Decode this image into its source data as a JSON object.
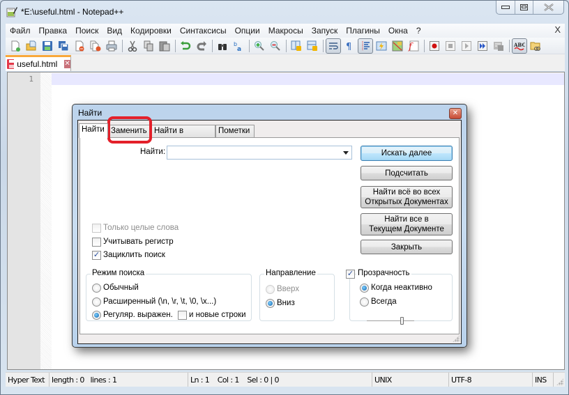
{
  "window": {
    "title": "*E:\\useful.html - Notepad++",
    "controls": [
      "minimize",
      "maximize",
      "close"
    ]
  },
  "menubar": {
    "items": [
      "Файл",
      "Правка",
      "Поиск",
      "Вид",
      "Кодировки",
      "Синтаксисы",
      "Опции",
      "Макросы",
      "Запуск",
      "Плагины",
      "Окна",
      "?"
    ],
    "close_label": "X"
  },
  "toolbar": {
    "buttons": [
      "new-file",
      "open-file",
      "save",
      "save-all",
      "close",
      "close-all",
      "print",
      "cut",
      "copy",
      "paste",
      "undo",
      "redo",
      "find",
      "replace",
      "zoom-in",
      "zoom-out",
      "sync-vertical",
      "sync-horizontal",
      "word-wrap",
      "show-all-chars",
      "indent-guide",
      "user-defined-language",
      "document-map",
      "function-list",
      "macro-record",
      "macro-stop",
      "macro-play",
      "macro-run-multiple",
      "macro-save",
      "spell-check",
      "folder-as-workspace"
    ]
  },
  "tabs": [
    {
      "label": "useful.html",
      "modified": true
    }
  ],
  "editor": {
    "line_numbers": [
      "1"
    ],
    "content": ""
  },
  "statusbar": {
    "language": "Hyper Text",
    "length": "length : 0",
    "lines": "lines : 1",
    "position": "Ln : 1    Col : 1    Sel : 0 | 0",
    "eol": "UNIX",
    "encoding": "UTF-8",
    "mode": "INS"
  },
  "dialog": {
    "title": "Найти",
    "tabs": [
      "Найти",
      "Заменить",
      "Найти в файлах",
      "Пометки"
    ],
    "active_tab": "Найти",
    "highlighted_tab": "Заменить",
    "find_label": "Найти:",
    "find_value": "",
    "buttons": {
      "find_next": "Искать далее",
      "count": "Подсчитать",
      "find_all_open_1": "Найти всё во всех",
      "find_all_open_2": "Открытых Документах",
      "find_all_current_1": "Найти все в",
      "find_all_current_2": "Текущем Документе",
      "close": "Закрыть"
    },
    "checkboxes": {
      "whole_word": {
        "label": "Только целые слова",
        "checked": false,
        "disabled": true
      },
      "match_case": {
        "label": "Учитывать регистр",
        "checked": false
      },
      "wrap_around": {
        "label": "Зациклить поиск",
        "checked": true
      }
    },
    "search_mode": {
      "title": "Режим поиска",
      "normal": "Обычный",
      "extended": "Расширенный (\\n, \\r, \\t, \\0, \\x...)",
      "regex": "Регуляр. выражен.",
      "newline": "и новые строки",
      "selected": "regex"
    },
    "direction": {
      "title": "Направление",
      "up": "Вверх",
      "down": "Вниз",
      "selected": "down"
    },
    "transparency": {
      "title": "Прозрачность",
      "enabled": true,
      "on_lose_focus": "Когда неактивно",
      "always": "Всегда",
      "selected": "on_lose_focus",
      "slider_value_percent": 75
    }
  },
  "colors": {
    "highlight_ring": "#e3202a",
    "tab_accent": "#f9a83b",
    "current_line": "#e8e8ff"
  }
}
